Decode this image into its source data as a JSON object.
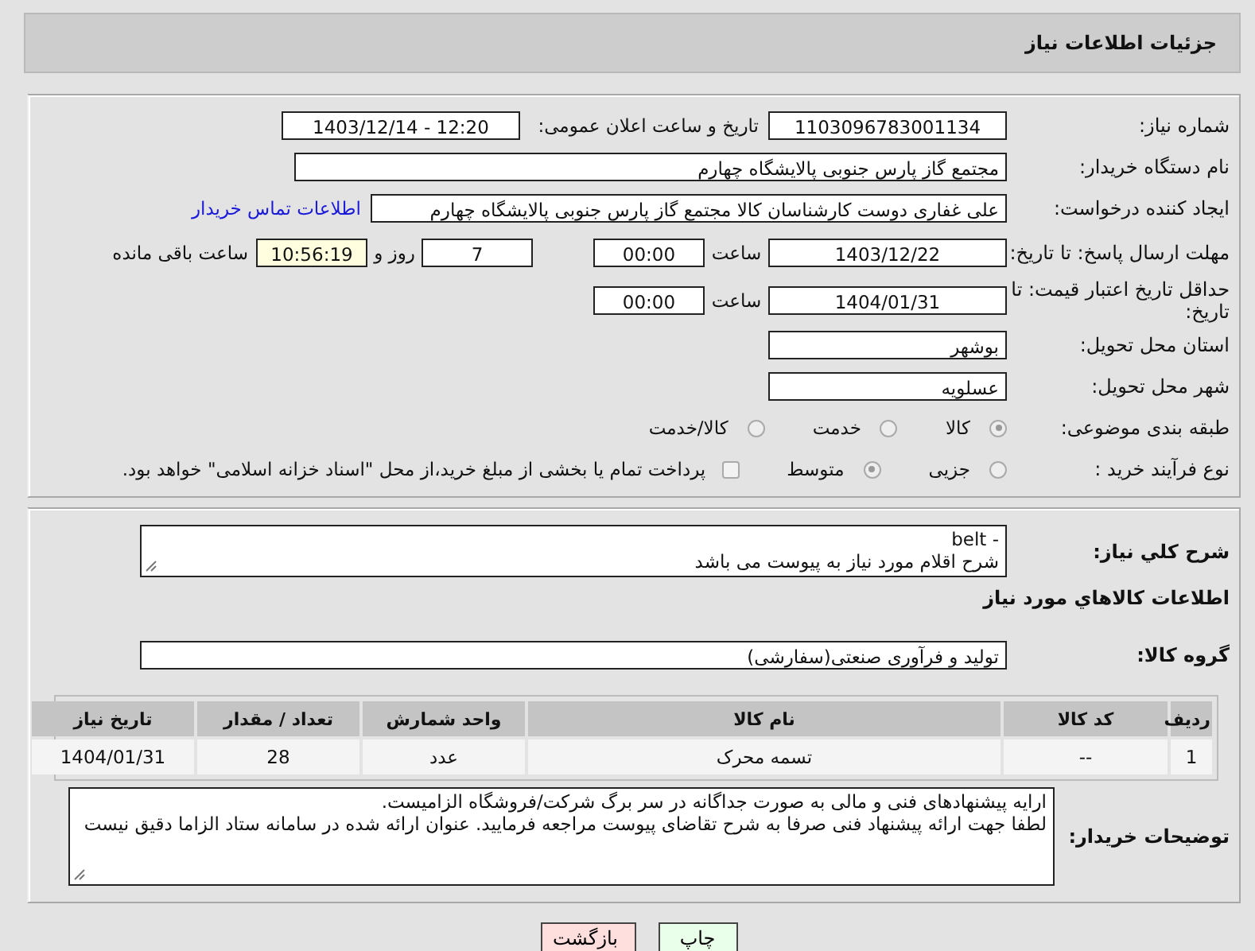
{
  "header": {
    "title": "جزئیات اطلاعات نیاز"
  },
  "need_number": {
    "label": "شماره نیاز:",
    "value": "1103096783001134"
  },
  "announce": {
    "label": "تاریخ و ساعت اعلان عمومی:",
    "value": "1403/12/14 - 12:20"
  },
  "buyer_org": {
    "label": "نام دستگاه خریدار:",
    "value": "مجتمع گاز پارس جنوبی  پالایشگاه چهارم"
  },
  "creator": {
    "label": "ایجاد کننده درخواست:",
    "value": "علی غفاری دوست کارشناسان کالا مجتمع گاز پارس جنوبی  پالایشگاه چهارم",
    "link": "اطلاعات تماس خریدار"
  },
  "reply_deadline": {
    "label": "مهلت ارسال پاسخ: تا تاریخ:",
    "date": "1403/12/22",
    "time_label": "ساعت",
    "time": "00:00",
    "days": "7",
    "days_label": "روز و",
    "remaining": "10:56:19",
    "remaining_label": "ساعت باقی مانده"
  },
  "price_validity": {
    "label": "حداقل تاریخ اعتبار قیمت: تا تاریخ:",
    "date": "1404/01/31",
    "time_label": "ساعت",
    "time": "00:00"
  },
  "province": {
    "label": "استان محل تحویل:",
    "value": "بوشهر"
  },
  "city": {
    "label": "شهر محل تحویل:",
    "value": "عسلویه"
  },
  "category": {
    "label": "طبقه بندی موضوعی:",
    "options": [
      {
        "label": "کالا",
        "selected": true
      },
      {
        "label": "خدمت",
        "selected": false
      },
      {
        "label": "کالا/خدمت",
        "selected": false
      }
    ]
  },
  "purchase_type": {
    "label": "نوع فرآیند خرید :",
    "options": [
      {
        "label": "جزیی",
        "selected": false
      },
      {
        "label": "متوسط",
        "selected": true
      }
    ],
    "treasury": {
      "label": "پرداخت تمام یا بخشی از مبلغ خرید،از محل \"اسناد خزانه اسلامی\" خواهد بود.",
      "checked": false
    }
  },
  "description": {
    "label": "شرح کلي نياز:",
    "value": "- belt\nشرح اقلام مورد نیاز به پیوست می باشد"
  },
  "items_title": "اطلاعات کالاهاي مورد نياز",
  "goods_group": {
    "label": "گروه کالا:",
    "value": "تولید و فرآوری صنعتی(سفارشی)"
  },
  "table": {
    "columns": [
      "ردیف",
      "کد کالا",
      "نام کالا",
      "واحد شمارش",
      "تعداد / مقدار",
      "تاریخ نیاز"
    ],
    "rows": [
      [
        "1",
        "--",
        "تسمه محرک",
        "عدد",
        "28",
        "1404/01/31"
      ]
    ]
  },
  "buyer_notes": {
    "label": "توضیحات خریدار:",
    "value": "ارایه پیشنهادهای فنی و مالی به صورت جداگانه در سر برگ شرکت/فروشگاه الزامیست.\nلطفا جهت ارائه پیشنهاد فنی صرفا به شرح تقاضای پیوست مراجعه فرمایید. عنوان ارائه شده در سامانه ستاد الزاما دقیق نیست"
  },
  "buttons": [
    {
      "label": "چاپ",
      "kind": "print"
    },
    {
      "label": "بازگشت",
      "kind": "back"
    }
  ]
}
